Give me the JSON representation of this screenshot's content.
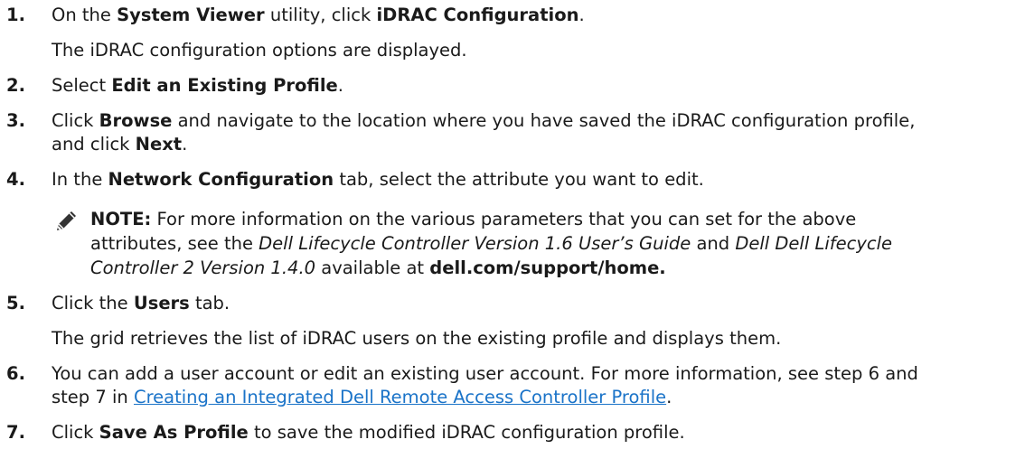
{
  "steps": [
    {
      "number": "1.",
      "parts": [
        "On the ",
        "System Viewer",
        " utility, click ",
        "iDRAC Configuration",
        "."
      ],
      "result": "The iDRAC configuration options are displayed."
    },
    {
      "number": "2.",
      "parts": [
        "Select ",
        "Edit an Existing Profile",
        "."
      ]
    },
    {
      "number": "3.",
      "parts": [
        "Click ",
        "Browse",
        " and navigate to the location where you have saved the iDRAC configuration profile,",
        "and click ",
        "Next",
        "."
      ]
    },
    {
      "number": "4.",
      "parts": [
        "In the ",
        "Network Configuration",
        " tab, select the attribute you want to edit."
      ]
    },
    {
      "number": "5.",
      "parts": [
        "Click the ",
        "Users",
        " tab."
      ],
      "result": "The grid retrieves the list of iDRAC users on the existing profile and displays them."
    },
    {
      "number": "6.",
      "parts": [
        "You can add a user account or edit an existing user account. For more information, see step 6 and",
        "step 7 in ",
        "Creating an Integrated Dell Remote Access Controller Profile",
        "."
      ]
    },
    {
      "number": "7.",
      "parts": [
        "Click ",
        "Save As Profile",
        " to save the modified iDRAC configuration profile."
      ]
    }
  ],
  "note": {
    "label": "NOTE:",
    "line1": " For more information on the various parameters that you can set for the above",
    "line2_a": "attributes, see the ",
    "line2_b": "Dell Lifecycle Controller Version 1.6 User’s Guide",
    "line2_c": " and ",
    "line2_d": "Dell Dell Lifecycle",
    "line3_a": "Controller 2 Version 1.4.0",
    "line3_b": " available at ",
    "line3_c": "dell.com/support/home."
  },
  "colors": {
    "link": "#1a73c8",
    "text": "#1a1a1a"
  },
  "icons": {
    "note": "pencil-note-icon"
  }
}
